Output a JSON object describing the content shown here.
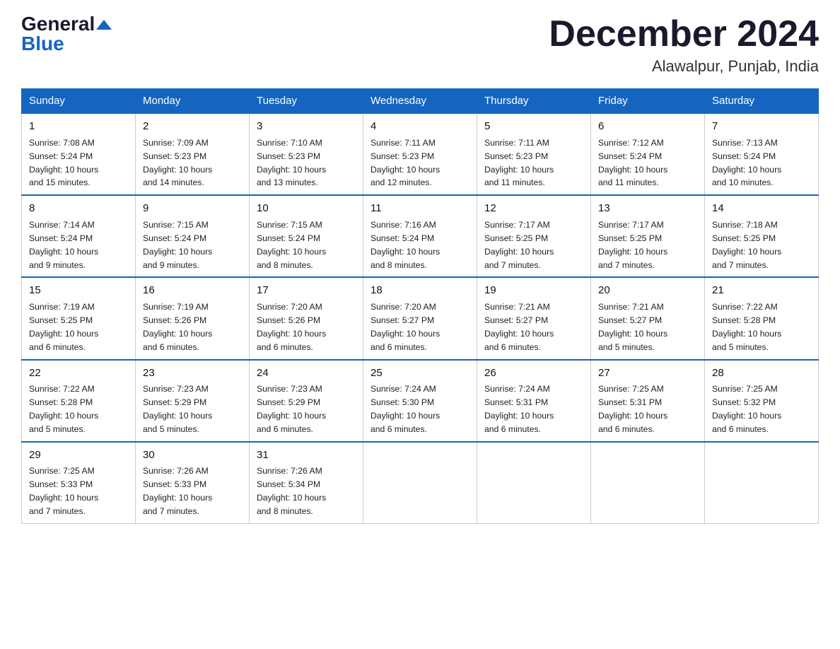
{
  "header": {
    "logo_general": "General",
    "logo_blue": "Blue",
    "month_title": "December 2024",
    "location": "Alawalpur, Punjab, India"
  },
  "days_of_week": [
    "Sunday",
    "Monday",
    "Tuesday",
    "Wednesday",
    "Thursday",
    "Friday",
    "Saturday"
  ],
  "weeks": [
    [
      {
        "day": "1",
        "sunrise": "7:08 AM",
        "sunset": "5:24 PM",
        "daylight": "10 hours and 15 minutes."
      },
      {
        "day": "2",
        "sunrise": "7:09 AM",
        "sunset": "5:23 PM",
        "daylight": "10 hours and 14 minutes."
      },
      {
        "day": "3",
        "sunrise": "7:10 AM",
        "sunset": "5:23 PM",
        "daylight": "10 hours and 13 minutes."
      },
      {
        "day": "4",
        "sunrise": "7:11 AM",
        "sunset": "5:23 PM",
        "daylight": "10 hours and 12 minutes."
      },
      {
        "day": "5",
        "sunrise": "7:11 AM",
        "sunset": "5:23 PM",
        "daylight": "10 hours and 11 minutes."
      },
      {
        "day": "6",
        "sunrise": "7:12 AM",
        "sunset": "5:24 PM",
        "daylight": "10 hours and 11 minutes."
      },
      {
        "day": "7",
        "sunrise": "7:13 AM",
        "sunset": "5:24 PM",
        "daylight": "10 hours and 10 minutes."
      }
    ],
    [
      {
        "day": "8",
        "sunrise": "7:14 AM",
        "sunset": "5:24 PM",
        "daylight": "10 hours and 9 minutes."
      },
      {
        "day": "9",
        "sunrise": "7:15 AM",
        "sunset": "5:24 PM",
        "daylight": "10 hours and 9 minutes."
      },
      {
        "day": "10",
        "sunrise": "7:15 AM",
        "sunset": "5:24 PM",
        "daylight": "10 hours and 8 minutes."
      },
      {
        "day": "11",
        "sunrise": "7:16 AM",
        "sunset": "5:24 PM",
        "daylight": "10 hours and 8 minutes."
      },
      {
        "day": "12",
        "sunrise": "7:17 AM",
        "sunset": "5:25 PM",
        "daylight": "10 hours and 7 minutes."
      },
      {
        "day": "13",
        "sunrise": "7:17 AM",
        "sunset": "5:25 PM",
        "daylight": "10 hours and 7 minutes."
      },
      {
        "day": "14",
        "sunrise": "7:18 AM",
        "sunset": "5:25 PM",
        "daylight": "10 hours and 7 minutes."
      }
    ],
    [
      {
        "day": "15",
        "sunrise": "7:19 AM",
        "sunset": "5:25 PM",
        "daylight": "10 hours and 6 minutes."
      },
      {
        "day": "16",
        "sunrise": "7:19 AM",
        "sunset": "5:26 PM",
        "daylight": "10 hours and 6 minutes."
      },
      {
        "day": "17",
        "sunrise": "7:20 AM",
        "sunset": "5:26 PM",
        "daylight": "10 hours and 6 minutes."
      },
      {
        "day": "18",
        "sunrise": "7:20 AM",
        "sunset": "5:27 PM",
        "daylight": "10 hours and 6 minutes."
      },
      {
        "day": "19",
        "sunrise": "7:21 AM",
        "sunset": "5:27 PM",
        "daylight": "10 hours and 6 minutes."
      },
      {
        "day": "20",
        "sunrise": "7:21 AM",
        "sunset": "5:27 PM",
        "daylight": "10 hours and 5 minutes."
      },
      {
        "day": "21",
        "sunrise": "7:22 AM",
        "sunset": "5:28 PM",
        "daylight": "10 hours and 5 minutes."
      }
    ],
    [
      {
        "day": "22",
        "sunrise": "7:22 AM",
        "sunset": "5:28 PM",
        "daylight": "10 hours and 5 minutes."
      },
      {
        "day": "23",
        "sunrise": "7:23 AM",
        "sunset": "5:29 PM",
        "daylight": "10 hours and 5 minutes."
      },
      {
        "day": "24",
        "sunrise": "7:23 AM",
        "sunset": "5:29 PM",
        "daylight": "10 hours and 6 minutes."
      },
      {
        "day": "25",
        "sunrise": "7:24 AM",
        "sunset": "5:30 PM",
        "daylight": "10 hours and 6 minutes."
      },
      {
        "day": "26",
        "sunrise": "7:24 AM",
        "sunset": "5:31 PM",
        "daylight": "10 hours and 6 minutes."
      },
      {
        "day": "27",
        "sunrise": "7:25 AM",
        "sunset": "5:31 PM",
        "daylight": "10 hours and 6 minutes."
      },
      {
        "day": "28",
        "sunrise": "7:25 AM",
        "sunset": "5:32 PM",
        "daylight": "10 hours and 6 minutes."
      }
    ],
    [
      {
        "day": "29",
        "sunrise": "7:25 AM",
        "sunset": "5:33 PM",
        "daylight": "10 hours and 7 minutes."
      },
      {
        "day": "30",
        "sunrise": "7:26 AM",
        "sunset": "5:33 PM",
        "daylight": "10 hours and 7 minutes."
      },
      {
        "day": "31",
        "sunrise": "7:26 AM",
        "sunset": "5:34 PM",
        "daylight": "10 hours and 8 minutes."
      },
      null,
      null,
      null,
      null
    ]
  ],
  "labels": {
    "sunrise": "Sunrise:",
    "sunset": "Sunset:",
    "daylight": "Daylight:"
  }
}
